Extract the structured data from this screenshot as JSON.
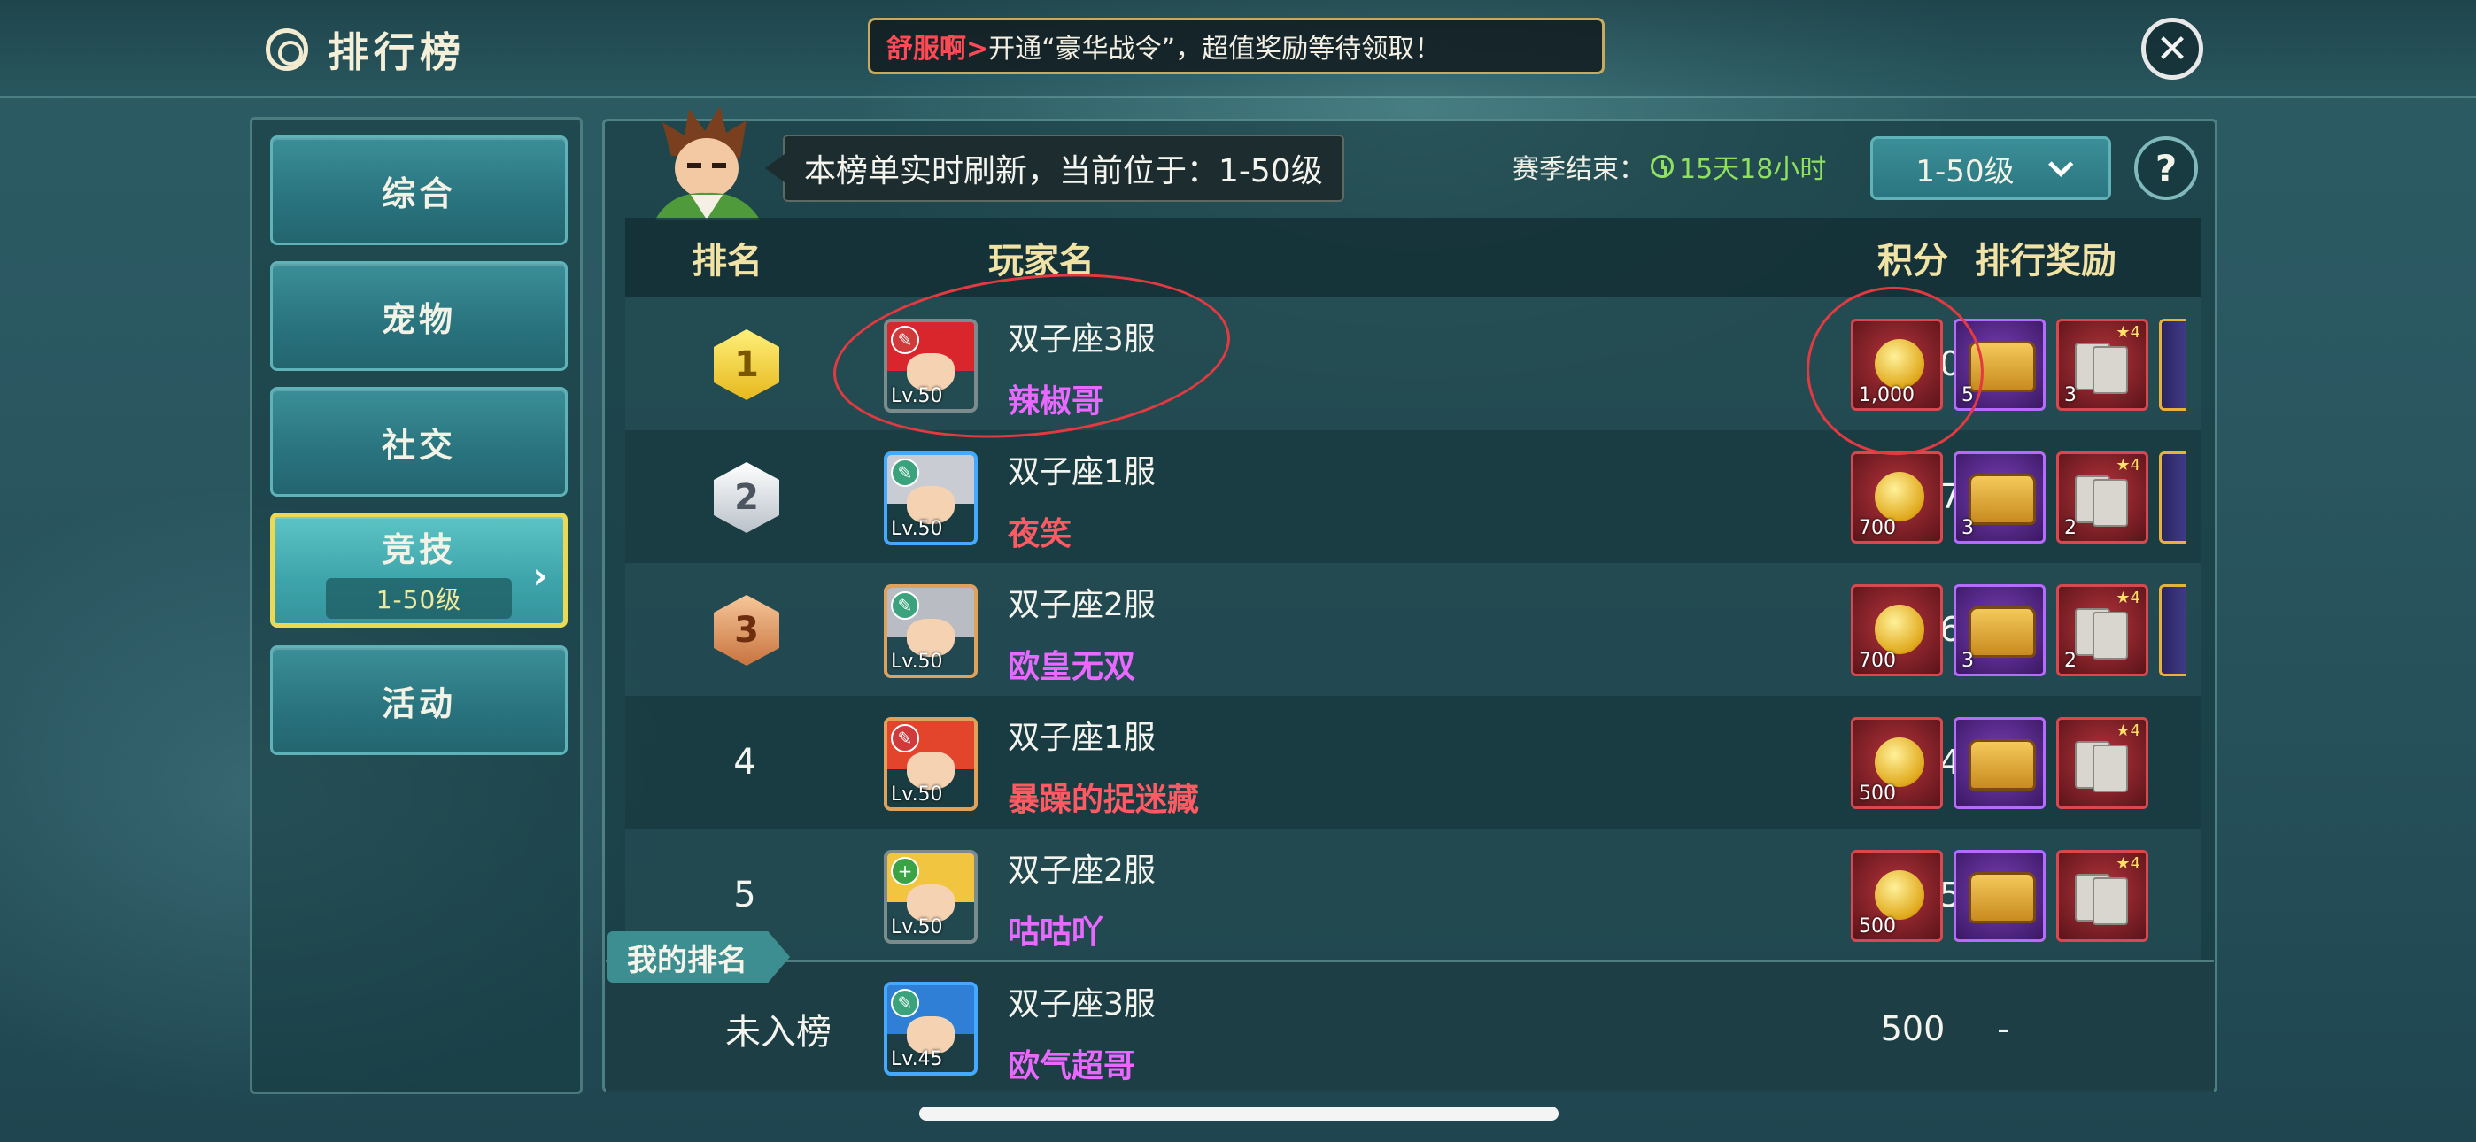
{
  "header": {
    "title": "排行榜",
    "banner_highlight": "舒服啊>",
    "banner_text": "开通“豪华战令”，超值奖励等待领取！"
  },
  "sidebar": {
    "items": [
      {
        "label": "综合"
      },
      {
        "label": "宠物"
      },
      {
        "label": "社交"
      },
      {
        "label": "竞技",
        "sub": "1-50级",
        "active": true
      },
      {
        "label": "活动"
      }
    ]
  },
  "info": {
    "bubble": "本榜单实时刷新，当前位于：1-50级",
    "season_label": "赛季结束：",
    "season_remaining": "15天18小时",
    "level_select": "1-50级",
    "help": "?"
  },
  "table": {
    "headers": [
      "排名",
      "玩家名",
      "积分",
      "排行奖励"
    ],
    "rows": [
      {
        "rank": "1",
        "server": "双子座3服",
        "name": "辣椒哥",
        "name_color": "#e968ff",
        "level": "Lv.50",
        "score": "3,070",
        "rewards": [
          "1,000",
          "5",
          "3"
        ]
      },
      {
        "rank": "2",
        "server": "双子座1服",
        "name": "夜笑",
        "name_color": "#ff5a63",
        "level": "Lv.50",
        "score": "2,657",
        "rewards": [
          "700",
          "3",
          "2"
        ]
      },
      {
        "rank": "3",
        "server": "双子座2服",
        "name": "欧皇无双",
        "name_color": "#e968ff",
        "level": "Lv.50",
        "score": "2,596",
        "rewards": [
          "700",
          "3",
          "2"
        ]
      },
      {
        "rank": "4",
        "server": "双子座1服",
        "name": "暴躁的捉迷藏",
        "name_color": "#ff5a63",
        "level": "Lv.50",
        "score": "2,484",
        "rewards": [
          "500",
          "",
          ""
        ]
      },
      {
        "rank": "5",
        "server": "双子座2服",
        "name": "咕咕吖",
        "name_color": "#e968ff",
        "level": "Lv.50",
        "score": "2,135",
        "rewards": [
          "500",
          "",
          ""
        ]
      }
    ]
  },
  "my_rank": {
    "tag": "我的排名",
    "status": "未入榜",
    "server": "双子座3服",
    "name": "欧气超哥",
    "level": "Lv.45",
    "score": "500",
    "reward": "-"
  },
  "colors": {
    "accent_gold": "#f1e2a6",
    "active_border": "#e9d955",
    "season_green": "#8fe05e",
    "annotation_red": "#e23a40"
  }
}
